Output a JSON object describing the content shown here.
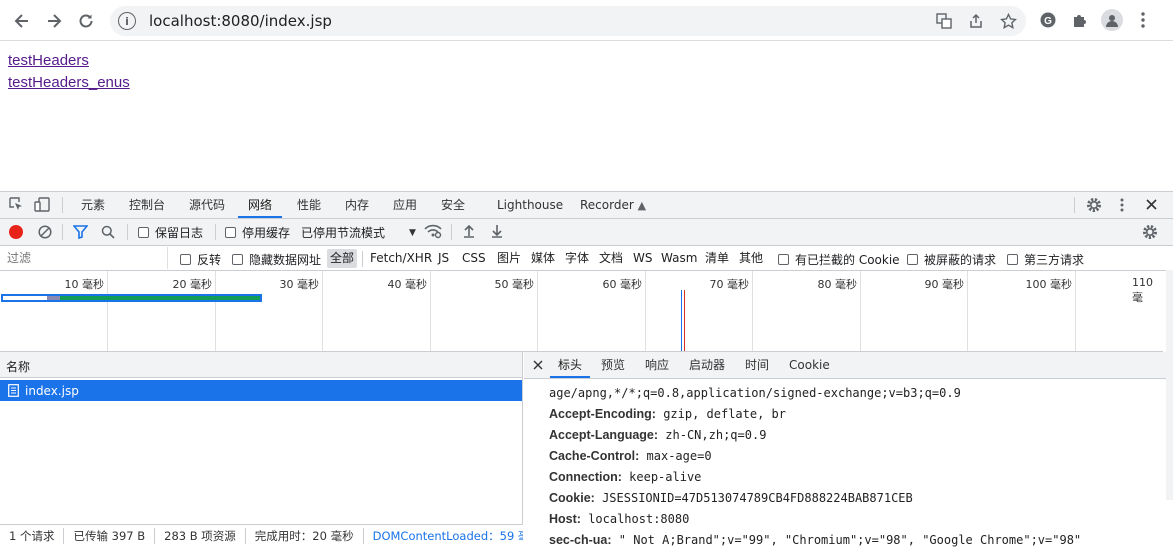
{
  "browser": {
    "url": "localhost:8080/index.jsp",
    "info_glyph": "i"
  },
  "page": {
    "links": [
      "testHeaders",
      "testHeaders_enus"
    ]
  },
  "devtools": {
    "panel_tabs": [
      "元素",
      "控制台",
      "源代码",
      "网络",
      "性能",
      "内存",
      "应用",
      "安全",
      "Lighthouse",
      "Recorder"
    ],
    "active_panel": "网络",
    "toolbar": {
      "preserve_log": "保留日志",
      "disable_cache": "停用缓存",
      "throttling": "已停用节流模式"
    },
    "filter": {
      "placeholder": "过滤",
      "invert": "反转",
      "hide_data_urls": "隐藏数据网址",
      "types": [
        "全部",
        "Fetch/XHR",
        "JS",
        "CSS",
        "图片",
        "媒体",
        "字体",
        "文档",
        "WS",
        "Wasm",
        "清单",
        "其他"
      ],
      "selected_type": "全部",
      "blocked_cookies": "有已拦截的 Cookie",
      "blocked_requests": "被屏蔽的请求",
      "third_party": "第三方请求"
    },
    "timeline": {
      "ticks": [
        "10 毫秒",
        "20 毫秒",
        "30 毫秒",
        "40 毫秒",
        "50 毫秒",
        "60 毫秒",
        "70 毫秒",
        "80 毫秒",
        "90 毫秒",
        "100 毫秒",
        "110 毫"
      ]
    },
    "requests": {
      "column_name": "名称",
      "rows": [
        {
          "name": "index.jsp"
        }
      ]
    },
    "status_bar": [
      "1 个请求",
      "已传输 397 B",
      "283 B 项资源",
      "完成用时：20 毫秒",
      "DOMContentLoaded：59 毫"
    ],
    "detail_tabs": [
      "标头",
      "预览",
      "响应",
      "启动器",
      "时间",
      "Cookie"
    ],
    "active_detail_tab": "标头",
    "headers": [
      {
        "name": "",
        "value": "age/apng,*/*;q=0.8,application/signed-exchange;v=b3;q=0.9"
      },
      {
        "name": "Accept-Encoding:",
        "value": "gzip, deflate, br"
      },
      {
        "name": "Accept-Language:",
        "value": "zh-CN,zh;q=0.9"
      },
      {
        "name": "Cache-Control:",
        "value": "max-age=0"
      },
      {
        "name": "Connection:",
        "value": "keep-alive"
      },
      {
        "name": "Cookie:",
        "value": "JSESSIONID=47D513074789CB4FD888224BAB871CEB"
      },
      {
        "name": "Host:",
        "value": "localhost:8080"
      },
      {
        "name": "sec-ch-ua:",
        "value": "\" Not A;Brand\";v=\"99\", \"Chromium\";v=\"98\", \"Google Chrome\";v=\"98\""
      }
    ]
  }
}
